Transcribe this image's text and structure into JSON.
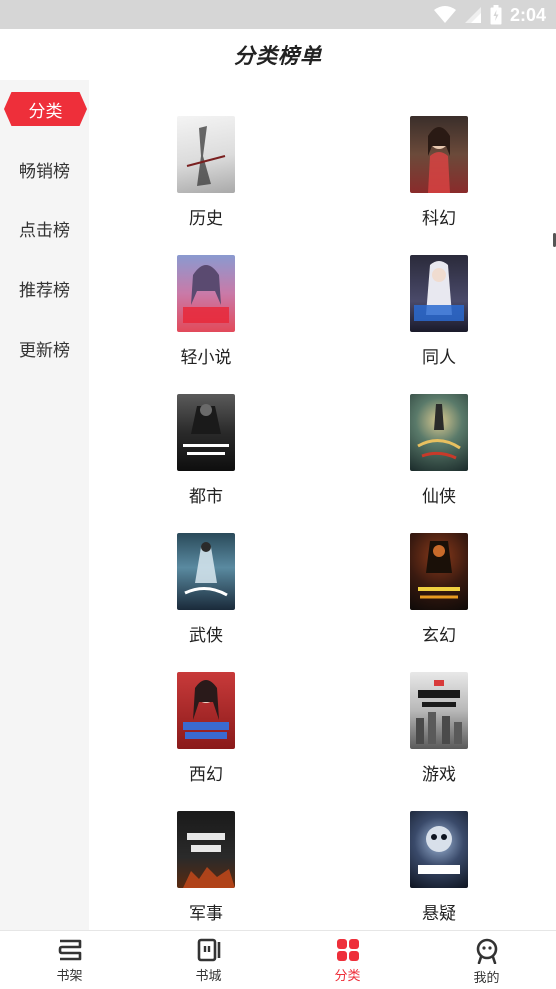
{
  "status_bar": {
    "time": "2:04",
    "icons": [
      "wifi-icon",
      "signal-icon",
      "battery-icon"
    ]
  },
  "header": {
    "title": "分类榜单"
  },
  "sidebar": {
    "items": [
      {
        "label": "分类",
        "active": true
      },
      {
        "label": "畅销榜",
        "active": false
      },
      {
        "label": "点击榜",
        "active": false
      },
      {
        "label": "推荐榜",
        "active": false
      },
      {
        "label": "更新榜",
        "active": false
      }
    ]
  },
  "categories": [
    {
      "label": "历史"
    },
    {
      "label": "科幻"
    },
    {
      "label": "轻小说"
    },
    {
      "label": "同人"
    },
    {
      "label": "都市"
    },
    {
      "label": "仙侠"
    },
    {
      "label": "武侠"
    },
    {
      "label": "玄幻"
    },
    {
      "label": "西幻"
    },
    {
      "label": "游戏"
    },
    {
      "label": "军事"
    },
    {
      "label": "悬疑"
    }
  ],
  "tabbar": {
    "tabs": [
      {
        "label": "书架",
        "icon": "bookshelf-icon",
        "active": false
      },
      {
        "label": "书城",
        "icon": "bookstore-icon",
        "active": false
      },
      {
        "label": "分类",
        "icon": "category-grid-icon",
        "active": true
      },
      {
        "label": "我的",
        "icon": "profile-icon",
        "active": false
      }
    ]
  },
  "colors": {
    "accent": "#ee2f3a",
    "sidebar_bg": "#f5f5f5",
    "status_bar_bg": "#d6d6d6"
  }
}
